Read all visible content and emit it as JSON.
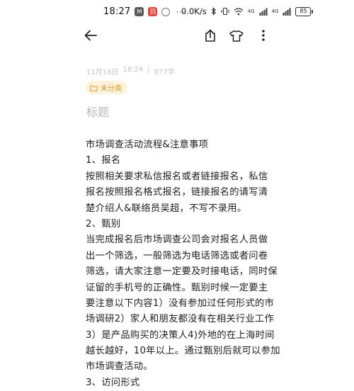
{
  "status_bar": {
    "time": "18:27",
    "app_badges": [
      "M",
      "回",
      "○"
    ],
    "more": "···",
    "net_speed": "0.0K/s",
    "network_label_1": "4G",
    "network_label_2": "4G",
    "battery_level": "85"
  },
  "toolbar": {
    "back_icon": "back-arrow-icon",
    "share_icon": "share-icon",
    "theme_icon": "shirt-icon",
    "more_icon": "more-vertical-icon"
  },
  "note": {
    "date": "11月16日",
    "time": "18:24",
    "separator": "|",
    "word_count": "877字",
    "folder_label": "未分类",
    "title_placeholder": "标题",
    "lines": [
      "市场调查活动流程&注意事项",
      "1、报名",
      "按照相关要求私信报名或者链接报名，私信",
      "报名按照报名格式报名，链接报名的请写清",
      "楚介绍人&联络员吴超，不写不录用。",
      "2、甄别",
      "当完成报名后市场调查公司会对报名人员做",
      "出一个筛选，一般筛选为电话筛选或者问卷",
      "筛选，请大家注意一定要及时接电话，同时保",
      "证留的手机号的正确性。甄别时候一定要主",
      "要注意以下内容1）没有参加过任何形式的市",
      "场调研2）家人和朋友都没有在相关行业工作",
      "3）是产品购买的决策人4)外地的在上海时间",
      "越长越好，10年以上。通过甄别后就可以参加",
      "市场调查活动。",
      "3、访问形式"
    ]
  }
}
